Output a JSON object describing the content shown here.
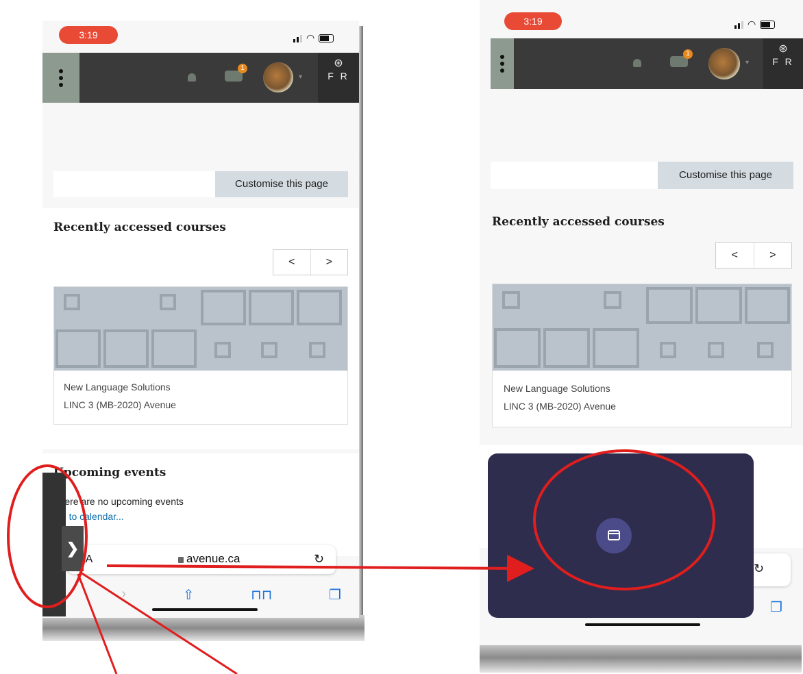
{
  "status": {
    "time": "3:19"
  },
  "navbar": {
    "lang_code": "F R",
    "notification_badge": "1"
  },
  "page": {
    "customise_label": "Customise this page",
    "recent_title": "Recently accessed courses",
    "prev": "<",
    "next": ">",
    "course_category": "New Language Solutions",
    "course_name": "LINC 3 (MB-2020) Avenue"
  },
  "upcoming": {
    "title": "Upcoming events",
    "empty": "There are no upcoming events",
    "link": "Go to calendar..."
  },
  "browser": {
    "text_size": "AA",
    "domain": "avenue.ca"
  },
  "drawer": {
    "toggle": "❯"
  },
  "colors": {
    "annotation": "#e01e1e",
    "overlay": "#2e2d4d",
    "accent": "#e84a36"
  }
}
